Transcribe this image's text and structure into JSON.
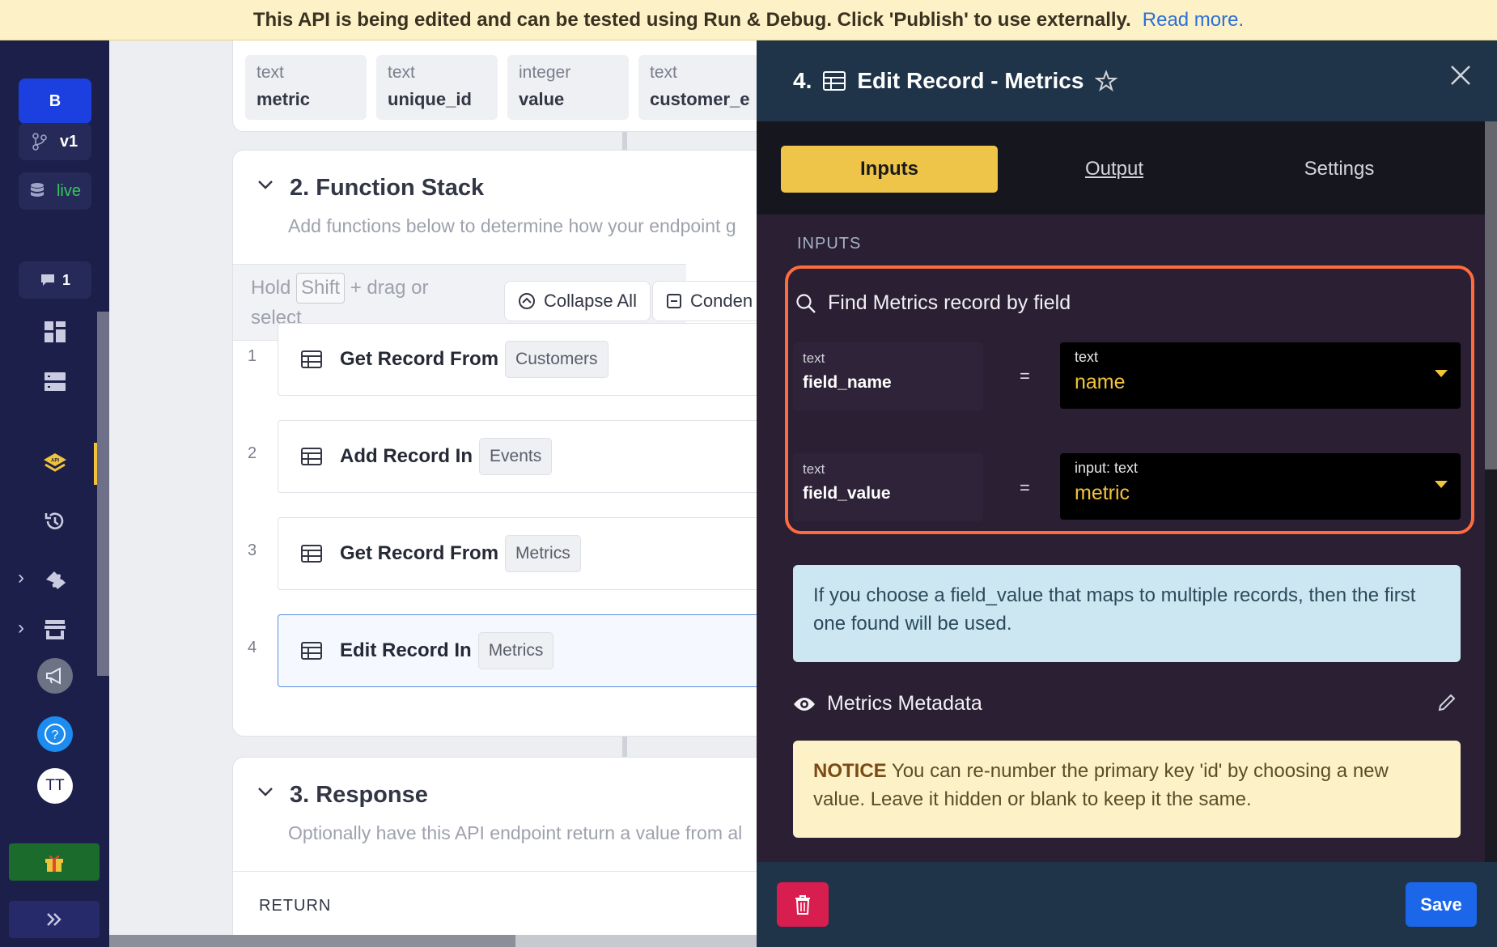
{
  "banner": {
    "message": "This API is being edited and can be tested using Run & Debug. Click 'Publish' to use externally.",
    "link": "Read more."
  },
  "sidebar": {
    "workspace_initial": "B",
    "branch": "v1",
    "datasource": "live",
    "comments_count": "1",
    "avatar_initials": "TT",
    "colors": {
      "accent": "#f0c33c",
      "live": "#34c759",
      "workspace": "#1c3fe0"
    }
  },
  "inputs_card": {
    "fields": [
      {
        "type": "text",
        "name": "metric"
      },
      {
        "type": "text",
        "name": "unique_id"
      },
      {
        "type": "integer",
        "name": "value"
      },
      {
        "type": "text",
        "name": "customer_e"
      }
    ]
  },
  "function_stack": {
    "title": "2. Function Stack",
    "subtitle": "Add functions below to determine how your endpoint g",
    "hold_prefix": "Hold",
    "hold_key": "Shift",
    "hold_suffix": "+ drag or select",
    "collapse_all": "Collapse All",
    "condense": "Conden",
    "steps": [
      {
        "num": "1",
        "label": "Get Record From",
        "tag": "Customers"
      },
      {
        "num": "2",
        "label": "Add Record In",
        "tag": "Events"
      },
      {
        "num": "3",
        "label": "Get Record From",
        "tag": "Metrics"
      },
      {
        "num": "4",
        "label": "Edit Record In",
        "tag": "Metrics"
      }
    ]
  },
  "response": {
    "title": "3. Response",
    "subtitle": "Optionally have this API endpoint return a value from al",
    "return_label": "RETURN"
  },
  "panel": {
    "step_num": "4.",
    "title": "Edit Record - Metrics",
    "tabs": {
      "inputs": "Inputs",
      "output": "Output",
      "settings": "Settings"
    },
    "inputs_label": "INPUTS",
    "find_label": "Find Metrics record by field",
    "rows": [
      {
        "label_type": "text",
        "label_name": "field_name",
        "op": "=",
        "value_type": "text",
        "value": "name"
      },
      {
        "label_type": "text",
        "label_name": "field_value",
        "op": "=",
        "value_type": "input: text",
        "value": "metric"
      }
    ],
    "info": "If you choose a field_value that maps to multiple records, then the first one found will be used.",
    "metadata_label": "Metrics Metadata",
    "notice_title": "NOTICE",
    "notice_text": "You can re-number the primary key 'id' by choosing a new value. Leave it hidden or blank to keep it the same.",
    "save": "Save"
  }
}
